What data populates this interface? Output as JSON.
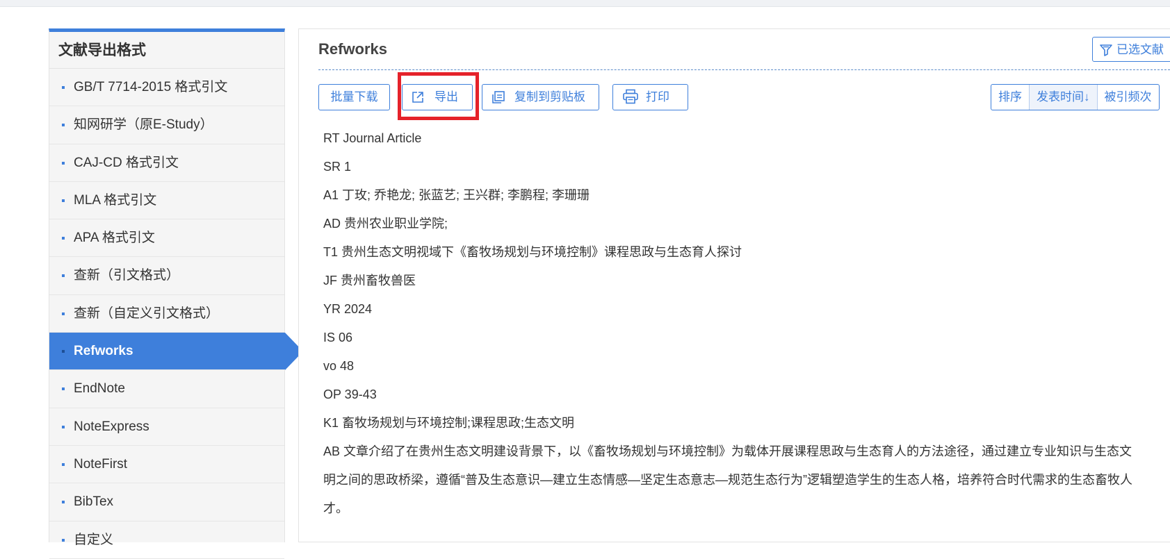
{
  "sidebar": {
    "title": "文献导出格式",
    "items": [
      {
        "label": "GB/T 7714-2015 格式引文"
      },
      {
        "label": "知网研学（原E-Study）"
      },
      {
        "label": "CAJ-CD 格式引文"
      },
      {
        "label": "MLA 格式引文"
      },
      {
        "label": "APA 格式引文"
      },
      {
        "label": "查新（引文格式）"
      },
      {
        "label": "查新（自定义引文格式）"
      },
      {
        "label": "Refworks",
        "active": true
      },
      {
        "label": "EndNote"
      },
      {
        "label": "NoteExpress"
      },
      {
        "label": "NoteFirst"
      },
      {
        "label": "BibTex"
      },
      {
        "label": "自定义"
      }
    ]
  },
  "main": {
    "title": "Refworks",
    "selected_label": "已选文献",
    "toolbar": {
      "batch_download": "批量下载",
      "export": "导出",
      "copy_clipboard": "复制到剪贴板",
      "print": "打印"
    },
    "sort": {
      "label": "排序",
      "pub_time": "发表时间",
      "cited": "被引频次"
    },
    "record": [
      "RT Journal Article",
      "SR 1",
      "A1  丁玫; 乔艳龙; 张蓝艺; 王兴群; 李鹏程; 李珊珊",
      "AD 贵州农业职业学院;",
      "T1 贵州生态文明视域下《畜牧场规划与环境控制》课程思政与生态育人探讨",
      "JF 贵州畜牧兽医",
      "YR 2024",
      "IS 06",
      "vo 48",
      "OP 39-43",
      "K1 畜牧场规划与环境控制;课程思政;生态文明",
      "AB 文章介绍了在贵州生态文明建设背景下，以《畜牧场规划与环境控制》为载体开展课程思政与生态育人的方法途径，通过建立专业知识与生态文明之间的思政桥梁，遵循“普及生态意识—建立生态情感—坚定生态意志—规范生态行为”逻辑塑造学生的生态人格，培养符合时代需求的生态畜牧人才。"
    ]
  },
  "colors": {
    "accent": "#3e7fdb",
    "highlight": "#e5222a"
  }
}
